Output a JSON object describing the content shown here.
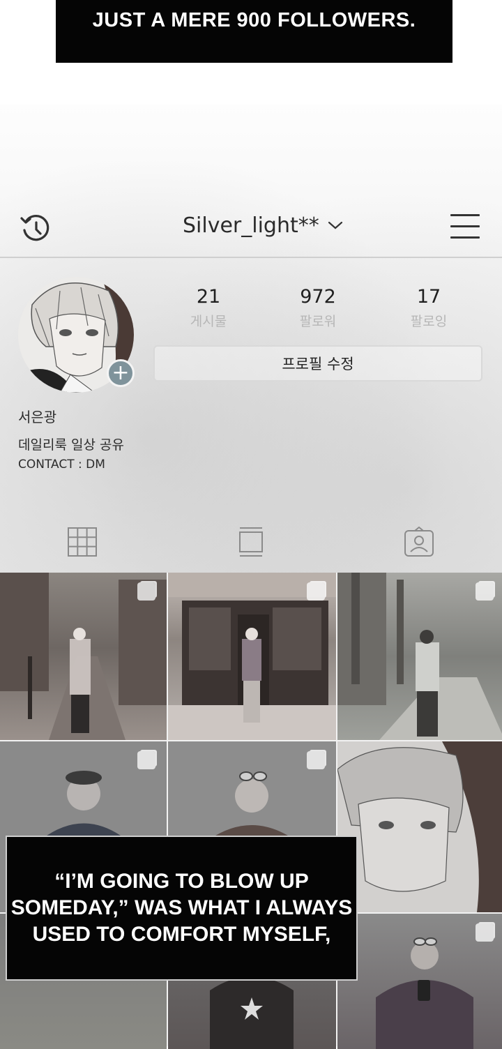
{
  "captions": {
    "top": "JUST A MERE 900 FOLLOWERS.",
    "bottom_lines": [
      "“I’M GOING TO BLOW UP",
      "SOMEDAY,” WAS WHAT I ALWAYS",
      "USED TO COMFORT MYSELF,"
    ]
  },
  "header": {
    "username": "Silver_light**"
  },
  "stats": [
    {
      "value": "21",
      "label": "게시물"
    },
    {
      "value": "972",
      "label": "팔로워"
    },
    {
      "value": "17",
      "label": "팔로잉"
    }
  ],
  "edit_profile_label": "프로필 수정",
  "bio": {
    "name": "서은광",
    "description": "데일리룩 일상 공유",
    "contact": "CONTACT : DM"
  },
  "icons": {
    "history": "history-icon",
    "menu": "hamburger-menu-icon",
    "grid_tab": "grid-icon",
    "reels_tab": "feed-icon",
    "tagged_tab": "tagged-person-icon",
    "add": "plus-icon"
  },
  "colors": {
    "caption_bg": "#050505",
    "caption_text": "#ffffff",
    "stat_label": "#b6b6b6",
    "plus_badge": "#7f939b"
  }
}
